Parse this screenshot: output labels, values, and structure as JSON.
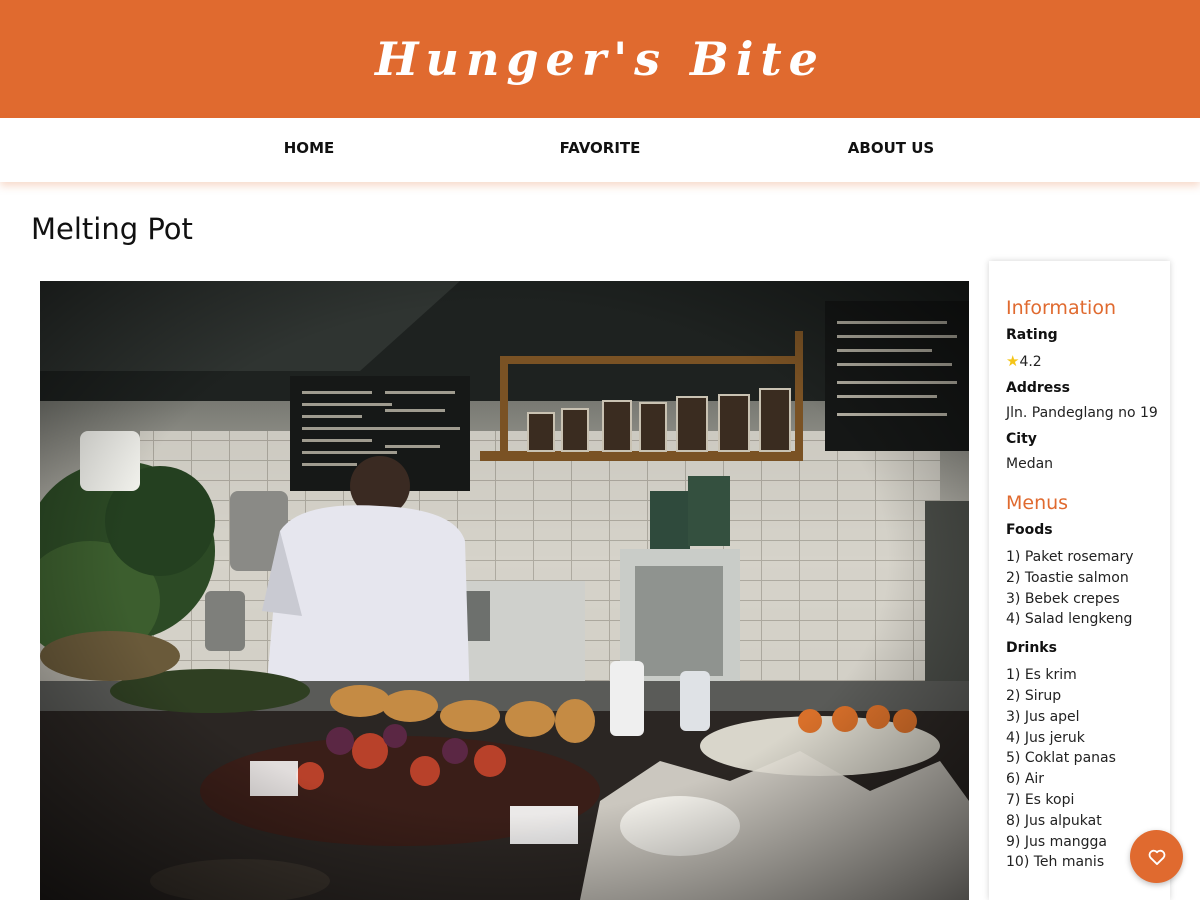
{
  "brand": {
    "title": "Hunger's Bite"
  },
  "nav": {
    "home": "HOME",
    "favorite": "FAVORITE",
    "about": "ABOUT US"
  },
  "restaurant": {
    "name": "Melting Pot"
  },
  "info": {
    "heading": "Information",
    "rating_label": "Rating",
    "rating_value": "4.2",
    "address_label": "Address",
    "address_value": "Jln. Pandeglang no 19",
    "city_label": "City",
    "city_value": "Medan"
  },
  "menus": {
    "heading": "Menus",
    "foods_label": "Foods",
    "foods": [
      "1) Paket rosemary",
      "2) Toastie salmon",
      "3) Bebek crepes",
      "4) Salad lengkeng"
    ],
    "drinks_label": "Drinks",
    "drinks": [
      "1) Es krim",
      "2) Sirup",
      "3) Jus apel",
      "4) Jus jeruk",
      "5) Coklat panas",
      "6) Air",
      "7) Es kopi",
      "8) Jus alpukat",
      "9) Jus mangga",
      "10) Teh manis"
    ]
  },
  "colors": {
    "accent": "#e06a2f",
    "star": "#f5c518"
  },
  "icons": {
    "rating": "star-icon",
    "favorite_button": "heart-icon"
  }
}
